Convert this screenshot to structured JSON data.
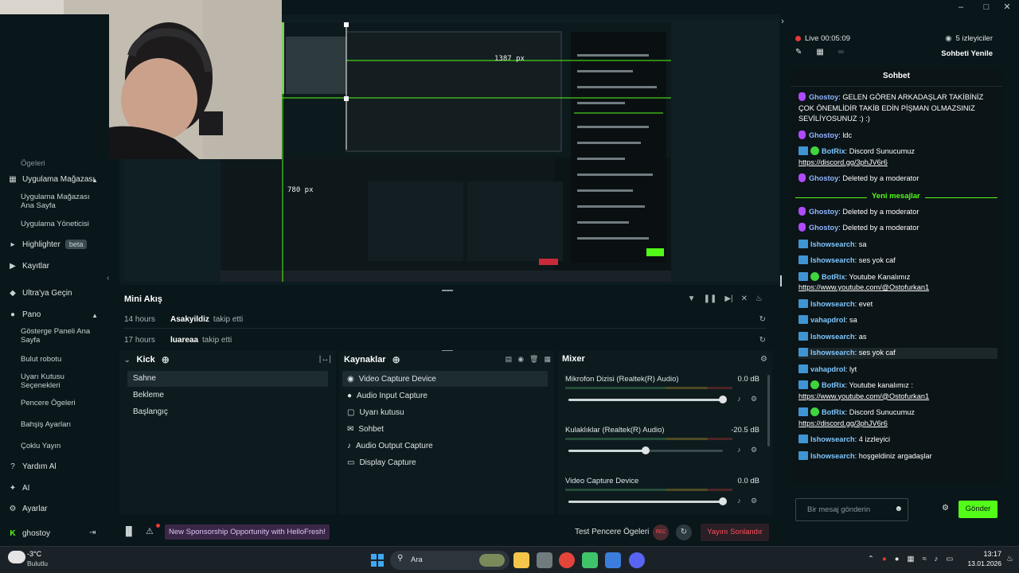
{
  "sidebar": {
    "truncated_top": "Ögeleri",
    "app_store": "Uygulama Mağazası",
    "app_store_home": "Uygulama Mağazası Ana Sayfa",
    "app_manager": "Uygulama Yöneticisi",
    "highlighter": "Highlighter",
    "highlighter_badge": "beta",
    "recordings": "Kayıtlar",
    "ultra": "Ultra'ya Geçin",
    "dashboard": "Pano",
    "dash_items": [
      "Gösterge Paneli Ana Sayfa",
      "Bulut robotu",
      "Uyarı Kutusu Seçenekleri",
      "Pencere Ögeleri",
      "Bahşiş Ayarları",
      "Çoklu Yayın"
    ],
    "help": "Yardım Al",
    "ai": "AI",
    "settings": "Ayarlar",
    "user": "ghostoy"
  },
  "preview": {
    "label_width": "1387 px",
    "label_height": "780 px"
  },
  "minifeed": {
    "title": "Mini Akış",
    "rows": [
      {
        "time": "14 hours",
        "user": "Asakyildiz",
        "action": "takip etti"
      },
      {
        "time": "17 hours",
        "user": "luareaa",
        "action": "takip etti"
      }
    ]
  },
  "scenes": {
    "title": "Kick",
    "items": [
      "Sahne",
      "Bekleme",
      "Başlangıç"
    ]
  },
  "sources": {
    "title": "Kaynaklar",
    "items": [
      {
        "label": "Video Capture Device",
        "icon": "camera-icon"
      },
      {
        "label": "Audio Input Capture",
        "icon": "microphone-icon"
      },
      {
        "label": "Uyarı kutusu",
        "icon": "alert-box-icon"
      },
      {
        "label": "Sohbet",
        "icon": "chat-icon"
      },
      {
        "label": "Audio Output Capture",
        "icon": "speaker-icon"
      },
      {
        "label": "Display Capture",
        "icon": "monitor-icon"
      }
    ]
  },
  "mixer": {
    "title": "Mixer",
    "channels": [
      {
        "name": "Mikrofon Dizisi (Realtek(R) Audio)",
        "db": "0.0 dB",
        "level": 1.0
      },
      {
        "name": "Kulaklıklar (Realtek(R) Audio)",
        "db": "-20.5 dB",
        "level": 0.5
      },
      {
        "name": "Video Capture Device",
        "db": "0.0 dB",
        "level": 1.0
      }
    ]
  },
  "bottombar": {
    "sponsor_text": "New Sponsorship Opportunity with HelloFresh!",
    "test_label": "Test Pencere Ögeleri",
    "rec_label": "REC",
    "end_stream": "Yayını Sonlandır"
  },
  "chat": {
    "live_status": "Live 00:05:09",
    "viewers": "5 izleyiciler",
    "refresh": "Sohbeti Yenile",
    "title": "Sohbet",
    "new_messages": "Yeni mesajlar",
    "messages": [
      {
        "user": "Ghostoy",
        "text": ": GELEN GÖREN ARKADAŞLAR TAKİBİNİZ ÇOK ÖNEMLİDİR TAKİB EDİN PİŞMAN OLMAZSINIZ SEVİLİYOSUNUZ :) :)",
        "kind": "ghost"
      },
      {
        "user": "Ghostoy",
        "text": ": ldc",
        "kind": "ghost"
      },
      {
        "user": "BotRix",
        "text": ": Discord Sunucumuz",
        "link": "https://discord.gg/3phJV6r6",
        "kind": "bot"
      },
      {
        "user": "Ghostoy",
        "text": ": Deleted by a moderator",
        "kind": "ghost"
      },
      {
        "user": "Ghostoy",
        "text": ": Deleted by a moderator",
        "kind": "ghost"
      },
      {
        "user": "Ghostoy",
        "text": ": Deleted by a moderator",
        "kind": "ghost"
      },
      {
        "user": "Ishowsearch",
        "text": ": sa",
        "kind": "ishow"
      },
      {
        "user": "Ishowsearch",
        "text": ": ses yok caf",
        "kind": "ishow"
      },
      {
        "user": "BotRix",
        "text": ": Youtube Kanalımız",
        "link": "https://www.youtube.com/@Ostofurkan1",
        "kind": "bot"
      },
      {
        "user": "Ishowsearch",
        "text": ": evet",
        "kind": "ishow"
      },
      {
        "user": "vahapdrol",
        "text": ": sa",
        "kind": "ishow"
      },
      {
        "user": "Ishowsearch",
        "text": ": as",
        "kind": "ishow"
      },
      {
        "user": "Ishowsearch",
        "text": ": ses yok caf",
        "kind": "ishow"
      },
      {
        "user": "vahapdrol",
        "text": ": lyt",
        "kind": "ishow"
      },
      {
        "user": "BotRix",
        "text": ": Youtube kanalımız :",
        "link": "https://www.youtube.com/@Ostofurkan1",
        "kind": "bot"
      },
      {
        "user": "BotRix",
        "text": ": Discord Sunucumuz",
        "link": "https://discord.gg/3phJV6r6",
        "kind": "bot"
      },
      {
        "user": "Ishowsearch",
        "text": ": 4 izzleyici",
        "kind": "ishow"
      },
      {
        "user": "Ishowsearch",
        "text": ": hoşgeldiniz argadaşlar",
        "kind": "ishow"
      }
    ],
    "input_placeholder": "Bir mesaj gönderin",
    "send": "Gönder"
  },
  "taskbar": {
    "weather_temp": "-3°C",
    "weather_desc": "Bulutlu",
    "search_placeholder": "Ara",
    "time": "13:17",
    "date": "13.01.2026"
  },
  "colors": {
    "accent_green": "#53fc18",
    "live_red": "#e53935",
    "end_stream_red": "#ff4d5e"
  }
}
